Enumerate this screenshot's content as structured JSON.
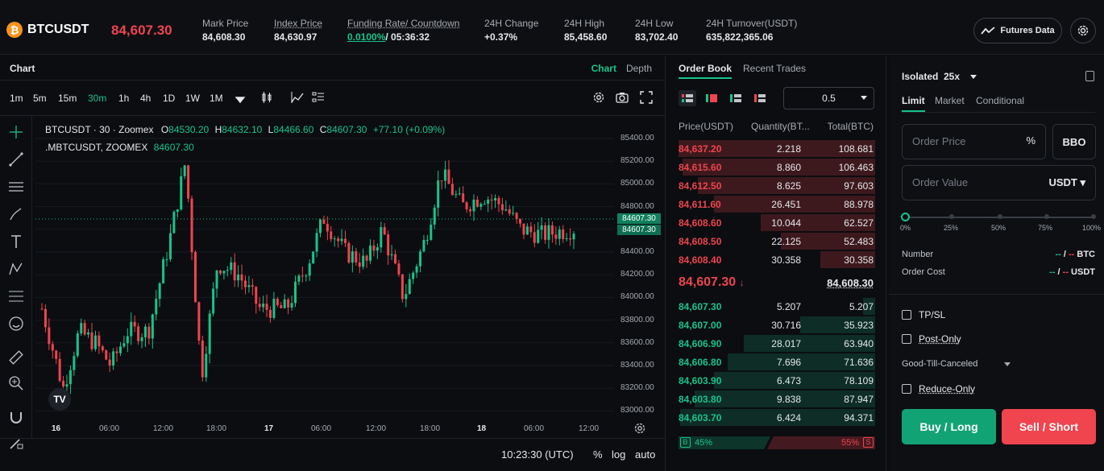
{
  "header": {
    "symbol": "BTCUSDT",
    "last_price": "84,607.30",
    "stats": [
      {
        "label": "Mark Price",
        "value": "84,608.30"
      },
      {
        "label": "Index Price",
        "value": "84,630.97"
      },
      {
        "label": "Funding Rate/ Countdown",
        "value_rate": "0.0100%",
        "value_countdown": "/ 05:36:32"
      },
      {
        "label": "24H Change",
        "value": "+0.37%"
      },
      {
        "label": "24H High",
        "value": "85,458.60"
      },
      {
        "label": "24H Low",
        "value": "83,702.40"
      },
      {
        "label": "24H Turnover(USDT)",
        "value": "635,822,365.06"
      }
    ],
    "futures_data_label": "Futures Data"
  },
  "chart_panel": {
    "title": "Chart",
    "tabs": [
      "Chart",
      "Depth"
    ],
    "timeframes": [
      "1m",
      "5m",
      "15m",
      "30m",
      "1h",
      "4h",
      "1D",
      "1W",
      "1M"
    ],
    "active_timeframe": "30m",
    "legend_line1_prefix": "BTCUSDT · 30 · Zoomex",
    "legend_ohlc": {
      "o_label": "O",
      "o": "84530.20",
      "h_label": "H",
      "h": "84632.10",
      "l_label": "L",
      "l": "84466.60",
      "c_label": "C",
      "c": "84607.30",
      "chg": "+77.10 (+0.09%)"
    },
    "legend_line2_prefix": ".MBTCUSDT, ZOOMEX",
    "legend_line2_value": "84607.30",
    "price_ticks": [
      "85400.00",
      "85200.00",
      "85000.00",
      "84800.00",
      "84600.00",
      "84400.00",
      "84200.00",
      "84000.00",
      "83800.00",
      "83600.00",
      "83400.00",
      "83200.00",
      "83000.00"
    ],
    "price_tags": [
      "84607.30",
      "84607.30"
    ],
    "time_ticks": [
      "16",
      "06:00",
      "12:00",
      "18:00",
      "17",
      "06:00",
      "12:00",
      "18:00",
      "18",
      "06:00",
      "12:00"
    ],
    "clock": "10:23:30 (UTC)",
    "footer_opts": [
      "%",
      "log",
      "auto"
    ],
    "up_color": "#17c48a",
    "down_color": "#f0444f"
  },
  "order_book": {
    "tabs": [
      "Order Book",
      "Recent Trades"
    ],
    "depth_value": "0.5",
    "headers": [
      "Price(USDT)",
      "Quantity(BT...",
      "Total(BTC)"
    ],
    "asks": [
      {
        "price": "84,637.20",
        "qty": "2.218",
        "total": "108.681",
        "depth": 1.0
      },
      {
        "price": "84,615.60",
        "qty": "8.860",
        "total": "106.463",
        "depth": 0.98
      },
      {
        "price": "84,612.50",
        "qty": "8.625",
        "total": "97.603",
        "depth": 0.9
      },
      {
        "price": "84,611.60",
        "qty": "26.451",
        "total": "88.978",
        "depth": 0.82
      },
      {
        "price": "84,608.60",
        "qty": "10.044",
        "total": "62.527",
        "depth": 0.58
      },
      {
        "price": "84,608.50",
        "qty": "22.125",
        "total": "52.483",
        "depth": 0.48
      },
      {
        "price": "84,608.40",
        "qty": "30.358",
        "total": "30.358",
        "depth": 0.28
      }
    ],
    "mid_price": "84,607.30",
    "mid_arrow": "↓",
    "mid_index": "84,608.30",
    "bids": [
      {
        "price": "84,607.30",
        "qty": "5.207",
        "total": "5.207",
        "depth": 0.06
      },
      {
        "price": "84,607.00",
        "qty": "30.716",
        "total": "35.923",
        "depth": 0.38
      },
      {
        "price": "84,606.90",
        "qty": "28.017",
        "total": "63.940",
        "depth": 0.67
      },
      {
        "price": "84,606.80",
        "qty": "7.696",
        "total": "71.636",
        "depth": 0.75
      },
      {
        "price": "84,603.90",
        "qty": "6.473",
        "total": "78.109",
        "depth": 0.82
      },
      {
        "price": "84,603.80",
        "qty": "9.838",
        "total": "87.947",
        "depth": 0.92
      },
      {
        "price": "84,603.70",
        "qty": "6.424",
        "total": "94.371",
        "depth": 0.99
      }
    ],
    "buy_ratio_label": "45%",
    "sell_ratio_label": "55%",
    "buy_ratio": 0.45,
    "badge_buy": "B",
    "badge_sell": "S"
  },
  "trade_panel": {
    "margin_mode": "Isolated",
    "leverage": "25x",
    "order_tabs": [
      "Limit",
      "Market",
      "Conditional"
    ],
    "price_placeholder": "Order Price",
    "bbo_label": "BBO",
    "value_placeholder": "Order Value",
    "value_unit": "USDT",
    "slider_marks": [
      "0%",
      "25%",
      "50%",
      "75%",
      "100%"
    ],
    "slider_value": 0,
    "number_label": "Number",
    "number_value_buy": "--",
    "number_value_sell": "--",
    "number_unit": "BTC",
    "cost_label": "Order Cost",
    "cost_value_buy": "--",
    "cost_value_sell": "--",
    "cost_unit": "USDT",
    "tpsl_label": "TP/SL",
    "post_only_label": "Post-Only",
    "tif_label": "Good-Till-Canceled",
    "reduce_only_label": "Reduce-Only",
    "buy_label": "Buy / Long",
    "sell_label": "Sell / Short"
  }
}
